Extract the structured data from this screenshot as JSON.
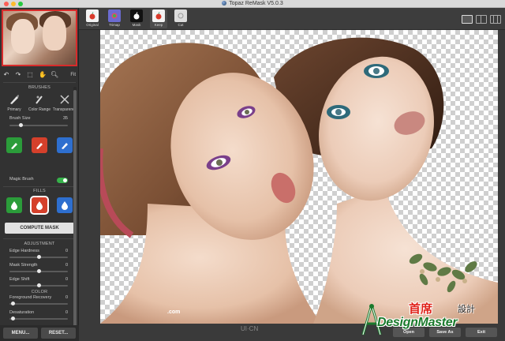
{
  "window": {
    "title": "Topaz ReMask V5.0.3"
  },
  "toolbar": {
    "zoom": "Fit",
    "modes": [
      {
        "label": "Original"
      },
      {
        "label": "Trimap"
      },
      {
        "label": "Mask"
      },
      {
        "label": "Keep"
      },
      {
        "label": "Cut"
      }
    ]
  },
  "brushes": {
    "header": "BRUSHES",
    "items": [
      {
        "label": "Primary"
      },
      {
        "label": "Color Range"
      },
      {
        "label": "Transparency"
      }
    ],
    "size_label": "Brush Size",
    "size_value": "35",
    "magic_label": "Magic Brush"
  },
  "fills": {
    "header": "FILLS"
  },
  "compute": {
    "label": "COMPUTE MASK"
  },
  "adjustment": {
    "header": "ADJUSTMENT",
    "rows": [
      {
        "label": "Edge Hardness",
        "value": "0"
      },
      {
        "label": "Mask Strength",
        "value": "0"
      },
      {
        "label": "Edge Shift",
        "value": "0"
      }
    ]
  },
  "color": {
    "header": "COLOR",
    "rows": [
      {
        "label": "Foreground Recovery",
        "value": "0"
      },
      {
        "label": "Desaturation",
        "value": "0"
      }
    ]
  },
  "buttons": {
    "menu": "MENU...",
    "reset": "RESET...",
    "open": "Open",
    "save_as": "Save As",
    "exit": "Exit"
  },
  "watermark": {
    "cn_main": "首席",
    "cn_sub": "設計",
    "en": "DesignMaster",
    "canvas_text": ".com",
    "center_mark": "UI·CN"
  },
  "colors": {
    "accent_red": "#d82b2b",
    "fill_green": "#2b9c3a",
    "fill_red": "#d5402b",
    "fill_blue": "#2e6fcf",
    "toggle_on": "#36b24a"
  }
}
